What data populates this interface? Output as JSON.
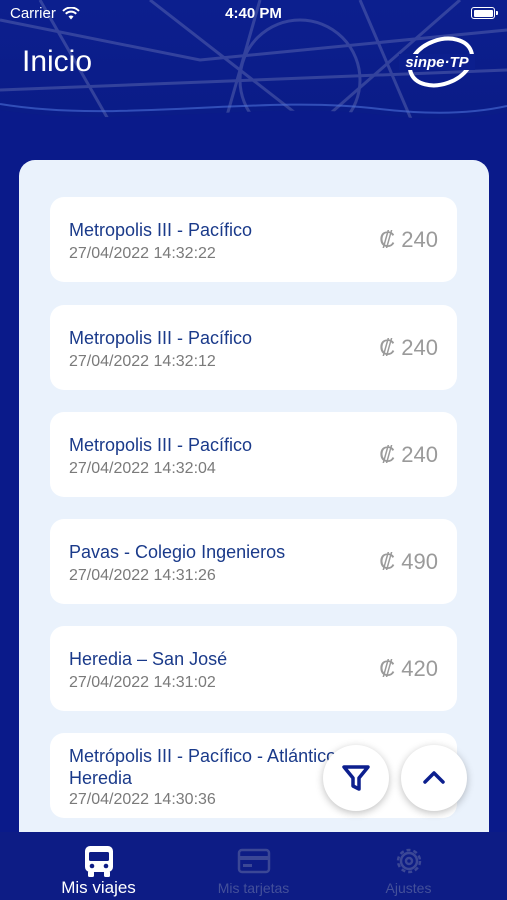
{
  "status_bar": {
    "carrier": "Carrier",
    "time": "4:40 PM"
  },
  "header": {
    "title": "Inicio",
    "logo_text": "sinpe·TP"
  },
  "trips": [
    {
      "route": "Metropolis III - Pacífico",
      "datetime": "27/04/2022 14:32:22",
      "price": "₡ 240"
    },
    {
      "route": "Metropolis III - Pacífico",
      "datetime": "27/04/2022 14:32:12",
      "price": "₡ 240"
    },
    {
      "route": "Metropolis III - Pacífico",
      "datetime": "27/04/2022 14:32:04",
      "price": "₡ 240"
    },
    {
      "route": "Pavas - Colegio Ingenieros",
      "datetime": "27/04/2022 14:31:26",
      "price": "₡ 490"
    },
    {
      "route": "Heredia – San José",
      "datetime": "27/04/2022 14:31:02",
      "price": "₡ 420"
    },
    {
      "route": "Metrópolis III - Pacífico - Atlántico - Heredia",
      "datetime": "27/04/2022 14:30:36",
      "price": ""
    }
  ],
  "tabs": [
    {
      "label": "Mis viajes",
      "icon": "bus-icon",
      "active": true
    },
    {
      "label": "Mis tarjetas",
      "icon": "card-icon",
      "active": false
    },
    {
      "label": "Ajustes",
      "icon": "gear-icon",
      "active": false
    }
  ],
  "colors": {
    "primary": "#0c1f8e",
    "route_text": "#1a3a8a",
    "card_bg": "#eaf2fc"
  }
}
